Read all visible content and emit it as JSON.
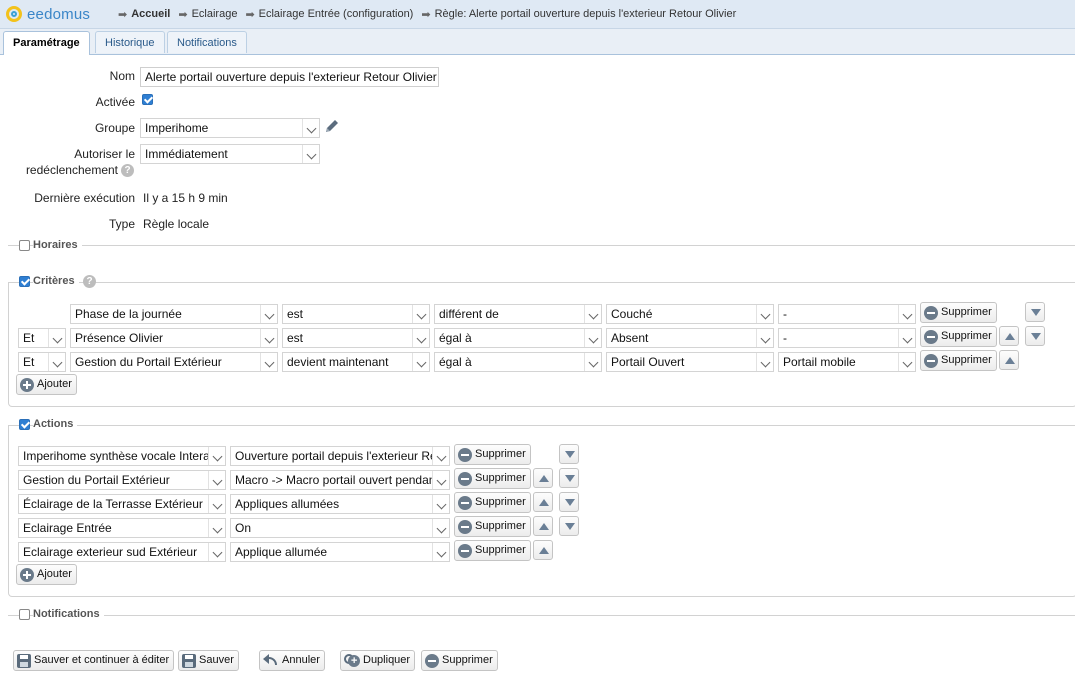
{
  "app": {
    "name": "eedomus"
  },
  "breadcrumb": [
    "Accueil",
    "Eclairage",
    "Eclairage Entrée (configuration)",
    "Règle: Alerte portail ouverture depuis l'exterieur Retour Olivier"
  ],
  "tabs": [
    "Paramétrage",
    "Historique",
    "Notifications"
  ],
  "form": {
    "nom_label": "Nom",
    "nom_value": "Alerte portail ouverture depuis l'exterieur Retour Olivier",
    "activee_label": "Activée",
    "groupe_label": "Groupe",
    "groupe_value": "Imperihome",
    "autoriser_label_1": "Autoriser le",
    "autoriser_label_2": "redéclenchement",
    "autoriser_value": "Immédiatement",
    "derniere_label": "Dernière exécution",
    "derniere_value": "Il y a 15 h 9 min",
    "type_label": "Type",
    "type_value": "Règle locale",
    "help_glyph": "?"
  },
  "sections": {
    "horaires": "Horaires",
    "criteres": "Critères",
    "actions": "Actions",
    "notifications": "Notifications"
  },
  "criteres": [
    {
      "conj": "",
      "device": "Phase de la journée",
      "verb": "est",
      "op": "différent de",
      "value": "Couché",
      "extra": "-",
      "up": false,
      "down": true
    },
    {
      "conj": "Et",
      "device": "Présence Olivier",
      "verb": "est",
      "op": "égal à",
      "value": "Absent",
      "extra": "-",
      "up": true,
      "down": true
    },
    {
      "conj": "Et",
      "device": "Gestion du Portail Extérieur",
      "verb": "devient maintenant",
      "op": "égal à",
      "value": "Portail Ouvert",
      "extra": "Portail mobile",
      "up": true,
      "down": false
    }
  ],
  "actions": [
    {
      "device": "Imperihome synthèse vocale Interactive",
      "value": "Ouverture portail depuis l'exterieur Retour Olivier",
      "up": false,
      "down": true
    },
    {
      "device": "Gestion du Portail Extérieur",
      "value": "Macro -> Macro portail ouvert pendant",
      "up": true,
      "down": true
    },
    {
      "device": "Éclairage de la Terrasse Extérieur",
      "value": "Appliques allumées",
      "up": true,
      "down": true
    },
    {
      "device": "Eclairage Entrée",
      "value": "On",
      "up": true,
      "down": true
    },
    {
      "device": "Eclairage exterieur sud Extérieur",
      "value": "Applique allumée",
      "up": true,
      "down": false
    }
  ],
  "buttons": {
    "supprimer": "Supprimer",
    "ajouter": "Ajouter",
    "save_continue": "Sauver et continuer à éditer",
    "save": "Sauver",
    "cancel": "Annuler",
    "duplicate": "Dupliquer",
    "delete": "Supprimer"
  },
  "colors": {
    "header_bg": "#dfe9f4",
    "accent": "#2f7fd3",
    "logo_text": "#3a86c8"
  }
}
